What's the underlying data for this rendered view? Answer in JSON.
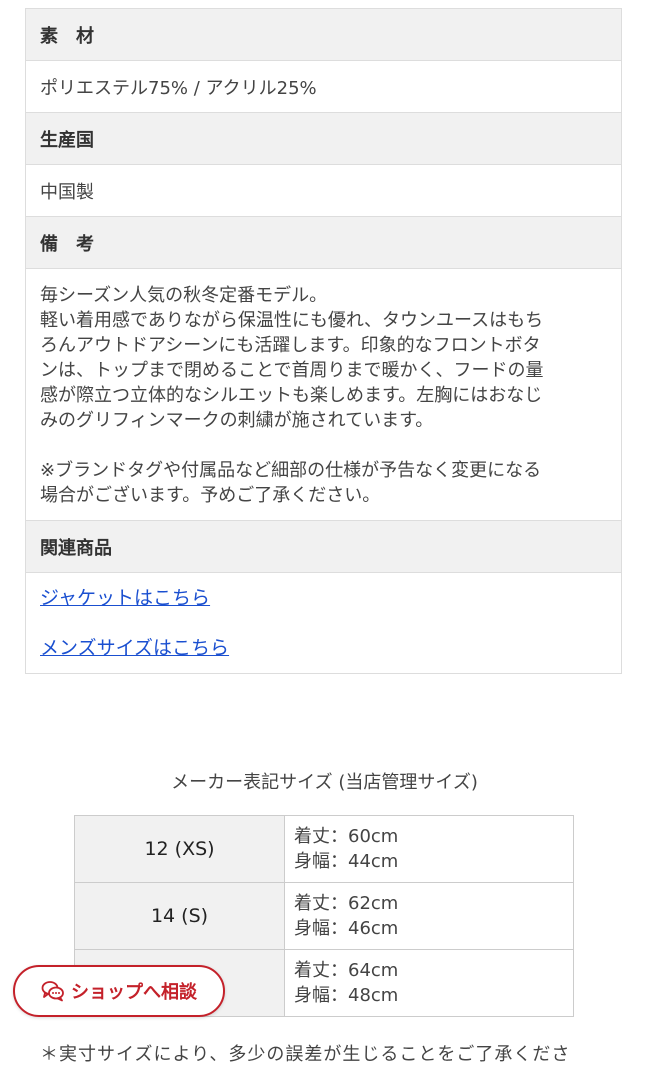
{
  "spec": {
    "material_label": "素　材",
    "material_value": "ポリエステル75% / アクリル25%",
    "origin_label": "生産国",
    "origin_value": "中国製",
    "notes_label": "備　考",
    "notes_paragraph1": "毎シーズン人気の秋冬定番モデル。\n軽い着用感でありながら保温性にも優れ、タウンユースはもち\nろんアウトドアシーンにも活躍します。印象的なフロントボタ\nンは、トップまで閉めることで首周りまで暖かく、フードの量\n感が際立つ立体的なシルエットも楽しめます。左胸にはおなじ\nみのグリフィンマークの刺繍が施されています。",
    "notes_paragraph2": "※ブランドタグや付属品など細部の仕様が予告なく変更になる\n場合がございます。予めご了承ください。",
    "related_label": "関連商品",
    "related_links": [
      "ジャケットはこちら",
      "メンズサイズはこちら"
    ]
  },
  "size_chart": {
    "caption": "メーカー表記サイズ (当店管理サイズ)",
    "rows": [
      {
        "label": "12 (XS)",
        "length": "着丈：60cm",
        "width": "身幅：44cm"
      },
      {
        "label": "14 (S)",
        "length": "着丈：62cm",
        "width": "身幅：46cm"
      },
      {
        "label": "",
        "length": "着丈：64cm",
        "width": "身幅：48cm"
      }
    ],
    "note": "＊実寸サイズにより、多少の誤差が生じることをご了承くださ"
  },
  "consult_button": {
    "label": "ショップへ相談",
    "icon": "chat-bubble-icon",
    "color": "#c4212a"
  }
}
